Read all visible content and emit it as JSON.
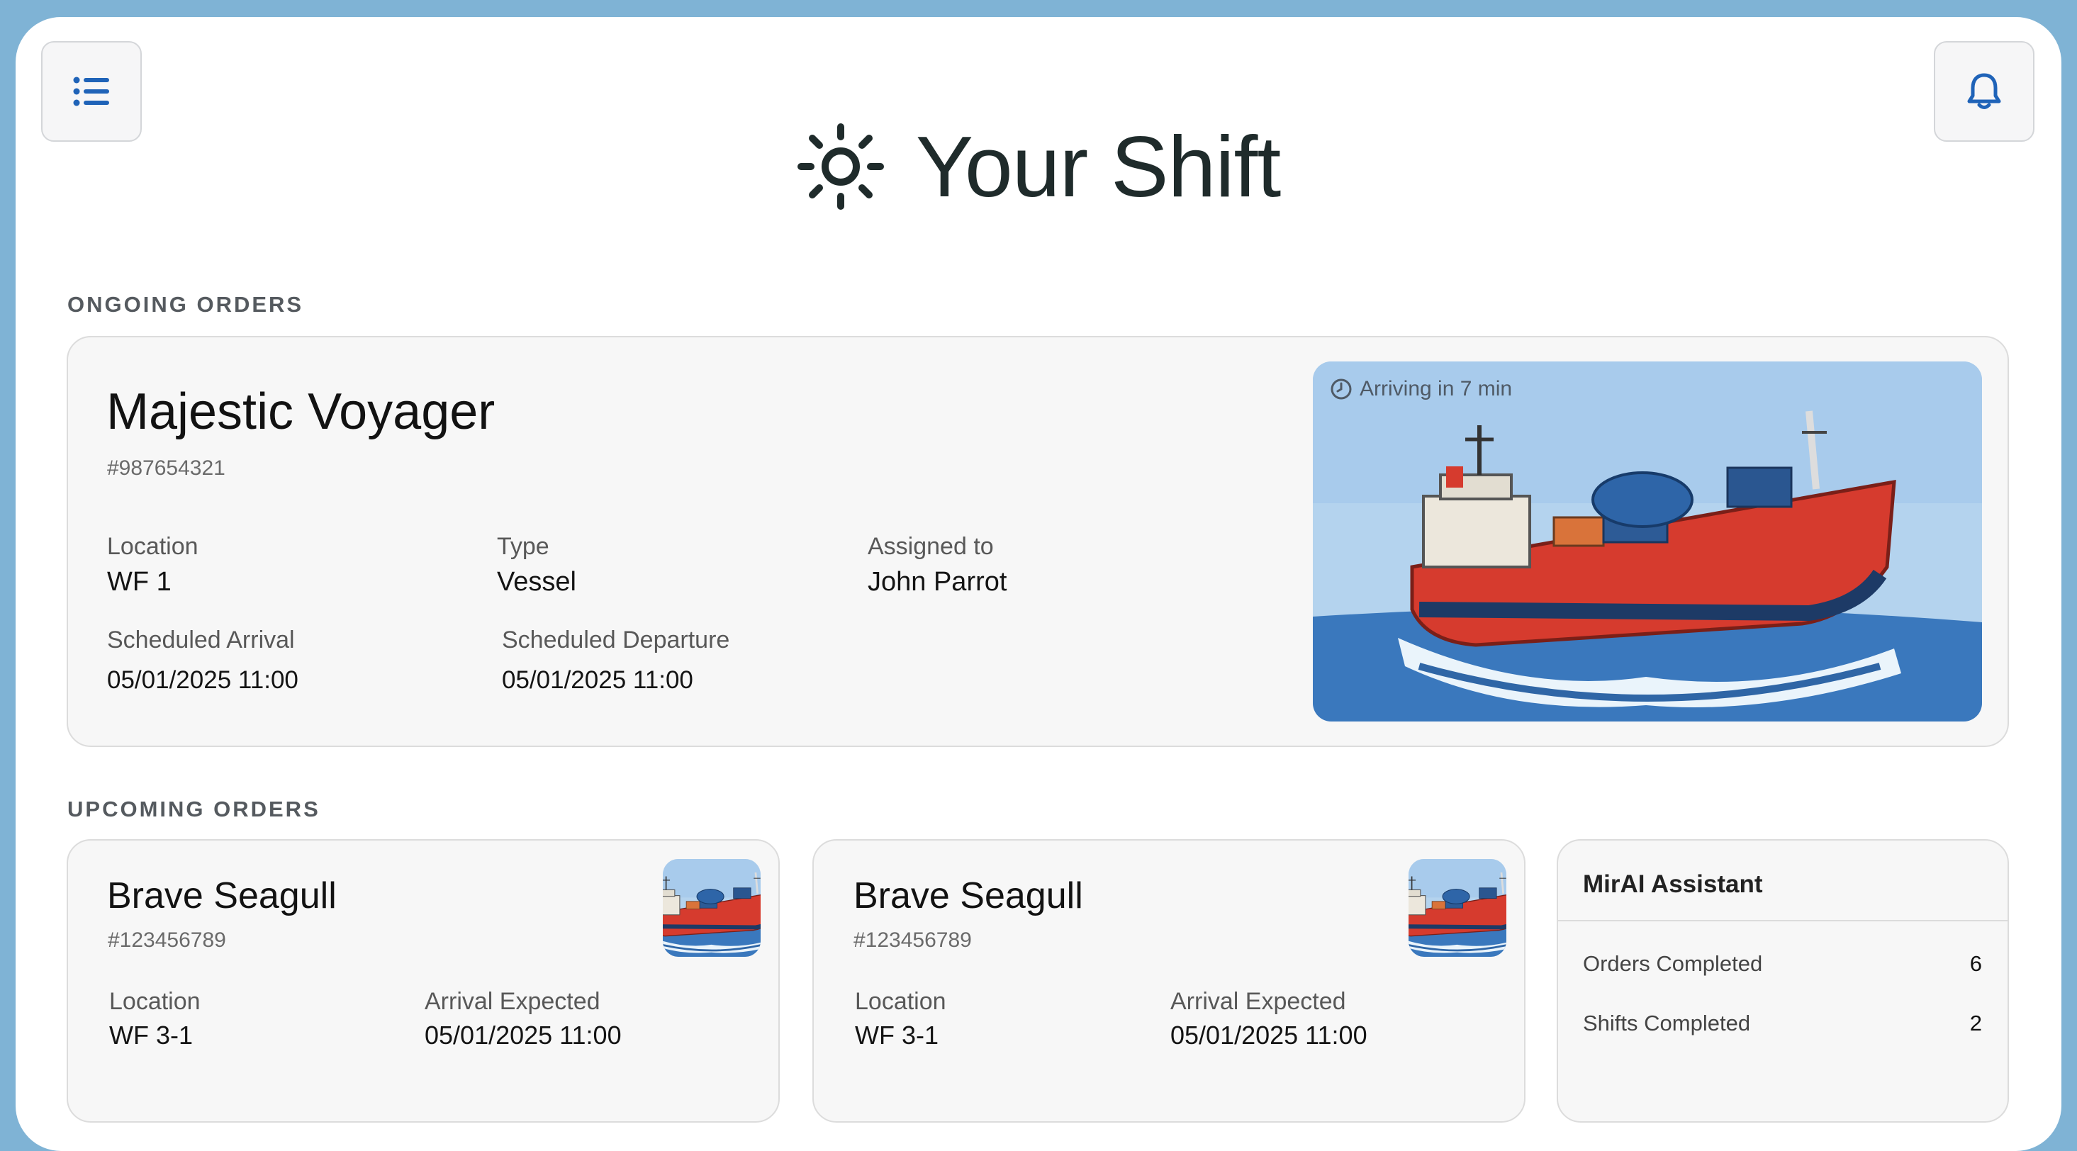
{
  "header": {
    "title": "Your Shift",
    "menu_icon": "list-menu-icon",
    "notification_icon": "bell-icon",
    "title_icon": "sun-icon"
  },
  "ongoing": {
    "section_label": "ONGOING ORDERS",
    "order": {
      "name": "Majestic Voyager",
      "id": "#987654321",
      "location_label": "Location",
      "location": "WF 1",
      "type_label": "Type",
      "type": "Vessel",
      "assigned_label": "Assigned to",
      "assigned": "John Parrot",
      "arrival_label": "Scheduled Arrival",
      "arrival": "05/01/2025 11:00",
      "departure_label": "Scheduled Departure",
      "departure": "05/01/2025 11:00",
      "eta": "Arriving in 7 min",
      "eta_icon": "clock-icon"
    }
  },
  "upcoming": {
    "section_label": "UPCOMING ORDERS",
    "orders": [
      {
        "name": "Brave Seagull",
        "id": "#123456789",
        "location_label": "Location",
        "location": "WF 3-1",
        "arrival_label": "Arrival Expected",
        "arrival": "05/01/2025 11:00"
      },
      {
        "name": "Brave Seagull",
        "id": "#123456789",
        "location_label": "Location",
        "location": "WF 3-1",
        "arrival_label": "Arrival Expected",
        "arrival": "05/01/2025 11:00"
      }
    ]
  },
  "assistant": {
    "title": "MirAI Assistant",
    "stats": [
      {
        "label": "Orders Completed",
        "value": "6"
      },
      {
        "label": "Shifts Completed",
        "value": "2"
      }
    ]
  },
  "colors": {
    "frame": "#7fb3d5",
    "accent": "#1f63b8",
    "hull": "#d63b2e",
    "sea": "#3a78bd",
    "sky": "#b4d3ee"
  }
}
